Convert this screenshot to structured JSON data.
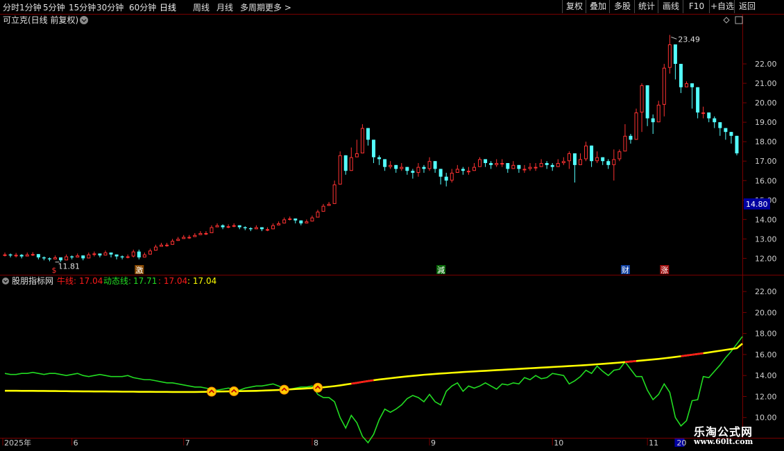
{
  "toolbar": {
    "periods": [
      "分时",
      "1分钟",
      "5分钟",
      "15分钟",
      "30分钟",
      "60分钟",
      "日线",
      "周线",
      "月线",
      "多周期",
      "更多 >"
    ],
    "active_period": "日线",
    "right_buttons": [
      "复权",
      "叠加",
      "多股",
      "统计",
      "画线",
      "F10",
      "+自选",
      "返回"
    ]
  },
  "main_panel": {
    "title": "可立克(日线 前复权)",
    "high_label": "23.49",
    "low_label": "11.81",
    "current_price_label": "14.80",
    "events": [
      {
        "label": "$",
        "index": 9,
        "color": "#ff3030",
        "bg": "#000000"
      },
      {
        "label": "激",
        "index": 24,
        "color": "#ffffff",
        "bg": "#8a4a00"
      },
      {
        "label": "減",
        "index": 78,
        "color": "#ffffff",
        "bg": "#0a6a0a"
      },
      {
        "label": "财",
        "index": 111,
        "color": "#ffffff",
        "bg": "#1040a0"
      },
      {
        "label": "涨",
        "index": 118,
        "color": "#ffffff",
        "bg": "#a01010"
      }
    ]
  },
  "indicator_panel": {
    "name": "股朋指标网",
    "niu_label": "牛线:",
    "niu_value": "17.04",
    "dong_label": "动态线:",
    "dong_value": "17.71",
    "extra1": ": 17.04",
    "extra2": ": 17.04",
    "signal_indices": [
      37,
      41,
      50,
      56
    ]
  },
  "time_axis": {
    "labels": [
      {
        "text": "2025年",
        "index": 0
      },
      {
        "text": "6",
        "index": 12
      },
      {
        "text": "7",
        "index": 32
      },
      {
        "text": "8",
        "index": 55
      },
      {
        "text": "9",
        "index": 76
      },
      {
        "text": "10",
        "index": 98
      },
      {
        "text": "11",
        "index": 115
      },
      {
        "text": "20",
        "index": 120
      }
    ]
  },
  "watermark": {
    "cn": "乐淘公式网",
    "url": "www.60lt.com"
  },
  "colors": {
    "up": "#ff3232",
    "down": "#54ffff",
    "ma_yellow": "#ffff00",
    "ma_red": "#ff1a1a",
    "dynamic_green": "#22dd22",
    "grid_red": "#7a0000",
    "axis_text": "#d0d0d0"
  },
  "chart_data": {
    "type": "candlestick",
    "price_axis": {
      "min": 11.3,
      "max": 24.0,
      "ticks": [
        12.0,
        13.0,
        14.0,
        15.0,
        16.0,
        17.0,
        18.0,
        19.0,
        20.0,
        21.0,
        22.0
      ]
    },
    "indicator_axis": {
      "min": 8.0,
      "max": 23.0,
      "ticks": [
        10.0,
        12.0,
        14.0,
        16.0,
        18.0,
        20.0,
        22.0
      ]
    },
    "closes": [
      12.2,
      12.15,
      12.18,
      12.1,
      12.2,
      12.22,
      12.05,
      12.0,
      11.95,
      12.05,
      11.9,
      12.1,
      12.05,
      12.15,
      12.0,
      12.2,
      12.25,
      12.15,
      12.3,
      12.2,
      12.1,
      12.05,
      12.1,
      12.35,
      12.05,
      12.2,
      12.4,
      12.6,
      12.7,
      12.7,
      12.9,
      13.0,
      13.1,
      13.1,
      13.2,
      13.3,
      13.3,
      13.6,
      13.7,
      13.6,
      13.65,
      13.7,
      13.6,
      13.55,
      13.5,
      13.6,
      13.5,
      13.5,
      13.7,
      13.8,
      14.0,
      14.05,
      13.95,
      13.8,
      13.9,
      14.1,
      14.4,
      14.7,
      14.8,
      15.8,
      17.3,
      16.5,
      17.2,
      17.4,
      18.7,
      18.1,
      17.2,
      17.1,
      16.7,
      16.8,
      16.6,
      16.7,
      16.5,
      16.4,
      16.7,
      16.6,
      17.0,
      16.6,
      16.2,
      16.0,
      16.4,
      16.6,
      16.5,
      16.5,
      16.7,
      17.1,
      16.9,
      16.8,
      16.9,
      16.9,
      16.6,
      16.8,
      16.6,
      16.6,
      16.7,
      16.7,
      16.9,
      16.8,
      16.7,
      16.9,
      17.0,
      17.4,
      16.8,
      17.1,
      17.8,
      17.0,
      17.2,
      17.0,
      16.8,
      17.1,
      17.5,
      18.3,
      18.1,
      19.5,
      20.9,
      19.2,
      19.0,
      19.9,
      21.8,
      23.0,
      22.0,
      20.8,
      21.0,
      20.8,
      19.5,
      19.5,
      19.2,
      19.0,
      18.7,
      18.5,
      18.3,
      17.4
    ],
    "lows": [
      12.1,
      12.05,
      12.05,
      12.0,
      12.1,
      12.12,
      11.95,
      11.9,
      11.85,
      11.95,
      11.81,
      11.98,
      11.95,
      12.05,
      11.9,
      12.08,
      12.1,
      12.05,
      12.2,
      12.05,
      11.95,
      11.95,
      12.0,
      12.05,
      11.95,
      12.05,
      12.3,
      12.5,
      12.6,
      12.6,
      12.8,
      12.9,
      13.0,
      13.0,
      13.1,
      13.2,
      13.2,
      13.5,
      13.6,
      13.5,
      13.55,
      13.6,
      13.5,
      13.45,
      13.4,
      13.5,
      13.4,
      13.4,
      13.6,
      13.7,
      13.85,
      13.95,
      13.8,
      13.7,
      13.8,
      14.0,
      14.3,
      14.6,
      14.7,
      15.5,
      15.8,
      16.3,
      16.8,
      17.2,
      17.9,
      17.8,
      16.9,
      16.8,
      16.5,
      16.6,
      16.4,
      16.5,
      16.3,
      16.1,
      16.2,
      16.4,
      16.5,
      16.4,
      15.8,
      15.7,
      15.9,
      16.4,
      16.3,
      16.3,
      16.5,
      16.8,
      16.7,
      16.6,
      16.7,
      16.7,
      16.4,
      16.6,
      16.4,
      16.4,
      16.5,
      16.5,
      16.7,
      16.6,
      16.5,
      16.7,
      16.8,
      16.6,
      15.9,
      16.8,
      17.0,
      16.7,
      16.9,
      16.8,
      16.6,
      16.0,
      17.0,
      17.9,
      17.9,
      19.0,
      18.5,
      18.8,
      18.4,
      19.0,
      19.3,
      21.5,
      21.2,
      20.5,
      20.8,
      19.7,
      19.2,
      19.2,
      19.0,
      18.7,
      18.3,
      18.1,
      17.9,
      17.3
    ],
    "highs": [
      12.3,
      12.25,
      12.28,
      12.22,
      12.3,
      12.32,
      12.15,
      12.1,
      12.05,
      12.15,
      12.05,
      12.2,
      12.15,
      12.25,
      12.1,
      12.3,
      12.35,
      12.25,
      12.4,
      12.3,
      12.2,
      12.15,
      12.2,
      12.45,
      12.45,
      12.3,
      12.5,
      12.7,
      12.8,
      12.8,
      13.0,
      13.1,
      13.2,
      13.2,
      13.3,
      13.4,
      13.4,
      13.7,
      13.8,
      13.75,
      13.75,
      13.8,
      13.7,
      13.65,
      13.6,
      13.7,
      13.6,
      13.6,
      13.8,
      13.9,
      14.1,
      14.15,
      14.05,
      13.9,
      14.0,
      14.2,
      14.5,
      14.8,
      14.9,
      16.0,
      17.5,
      16.8,
      17.7,
      18.1,
      18.9,
      18.3,
      17.5,
      17.3,
      16.9,
      17.0,
      16.8,
      16.9,
      16.7,
      16.6,
      16.9,
      16.8,
      17.2,
      16.9,
      16.6,
      16.4,
      16.6,
      16.8,
      16.7,
      16.7,
      16.9,
      17.2,
      17.1,
      17.0,
      17.1,
      17.1,
      16.9,
      17.0,
      16.8,
      16.8,
      16.9,
      16.9,
      17.1,
      17.0,
      16.9,
      17.1,
      17.2,
      17.5,
      17.4,
      17.4,
      18.0,
      17.7,
      17.5,
      17.2,
      17.1,
      17.6,
      17.6,
      18.9,
      18.4,
      19.7,
      21.0,
      19.7,
      19.4,
      20.1,
      22.0,
      23.49,
      22.6,
      22.0,
      21.1,
      21.0,
      20.7,
      19.8,
      19.5,
      19.3,
      19.0,
      18.7,
      18.5,
      18.0
    ],
    "ma_line": [
      12.55,
      12.55,
      12.55,
      12.54,
      12.54,
      12.54,
      12.53,
      12.53,
      12.52,
      12.52,
      12.51,
      12.51,
      12.5,
      12.5,
      12.49,
      12.49,
      12.48,
      12.48,
      12.48,
      12.47,
      12.47,
      12.46,
      12.46,
      12.46,
      12.45,
      12.45,
      12.45,
      12.44,
      12.44,
      12.44,
      12.43,
      12.43,
      12.43,
      12.43,
      12.43,
      12.44,
      12.45,
      12.46,
      12.47,
      12.48,
      12.49,
      12.5,
      12.51,
      12.52,
      12.53,
      12.54,
      12.56,
      12.58,
      12.6,
      12.62,
      12.65,
      12.68,
      12.71,
      12.74,
      12.77,
      12.8,
      12.84,
      12.88,
      12.93,
      12.99,
      13.06,
      13.14,
      13.22,
      13.3,
      13.39,
      13.47,
      13.55,
      13.62,
      13.68,
      13.74,
      13.8,
      13.86,
      13.92,
      13.97,
      14.02,
      14.07,
      14.11,
      14.15,
      14.19,
      14.22,
      14.26,
      14.29,
      14.33,
      14.36,
      14.39,
      14.42,
      14.45,
      14.48,
      14.51,
      14.54,
      14.57,
      14.6,
      14.63,
      14.66,
      14.69,
      14.72,
      14.75,
      14.78,
      14.81,
      14.84,
      14.87,
      14.9,
      14.93,
      14.96,
      14.99,
      15.03,
      15.07,
      15.11,
      15.15,
      15.19,
      15.23,
      15.28,
      15.33,
      15.38,
      15.43,
      15.48,
      15.53,
      15.58,
      15.64,
      15.7,
      15.77,
      15.84,
      15.91,
      15.98,
      16.05,
      16.12,
      16.2,
      16.28,
      16.36,
      16.44,
      16.52,
      16.6,
      17.04
    ],
    "ma_red_segments": [
      [
        62,
        66
      ],
      [
        111,
        113
      ],
      [
        121,
        125
      ]
    ],
    "dynamic_line": [
      14.2,
      14.1,
      14.1,
      14.2,
      14.2,
      14.3,
      14.2,
      14.1,
      14.2,
      14.2,
      14.1,
      14.0,
      14.1,
      14.2,
      14.0,
      13.9,
      14.0,
      14.1,
      14.0,
      13.9,
      13.9,
      13.9,
      14.0,
      13.8,
      13.7,
      13.6,
      13.6,
      13.5,
      13.4,
      13.3,
      13.3,
      13.2,
      13.1,
      13.0,
      12.9,
      12.9,
      12.8,
      12.7,
      12.6,
      12.7,
      12.8,
      12.7,
      12.6,
      12.8,
      12.9,
      13.0,
      13.0,
      13.1,
      13.2,
      13.0,
      12.8,
      12.7,
      12.8,
      12.9,
      12.9,
      13.0,
      12.2,
      11.9,
      11.9,
      11.5,
      10.0,
      9.0,
      10.2,
      9.5,
      8.2,
      7.6,
      8.4,
      9.8,
      10.8,
      10.5,
      10.8,
      11.2,
      11.8,
      12.1,
      11.9,
      11.5,
      12.2,
      11.5,
      11.2,
      12.5,
      13.0,
      13.3,
      12.5,
      13.0,
      12.8,
      13.0,
      13.3,
      13.0,
      12.7,
      13.2,
      13.1,
      13.3,
      13.2,
      13.8,
      13.6,
      14.0,
      13.7,
      13.8,
      14.2,
      14.1,
      14.0,
      13.2,
      13.5,
      13.9,
      14.5,
      14.2,
      14.9,
      14.4,
      14.0,
      14.5,
      14.6,
      15.3,
      14.6,
      13.9,
      13.9,
      12.6,
      11.7,
      12.2,
      13.2,
      12.4,
      10.0,
      9.2,
      9.7,
      11.6,
      11.7,
      13.9,
      13.8,
      14.4,
      15.0,
      15.7,
      16.3,
      17.0,
      17.71
    ]
  }
}
